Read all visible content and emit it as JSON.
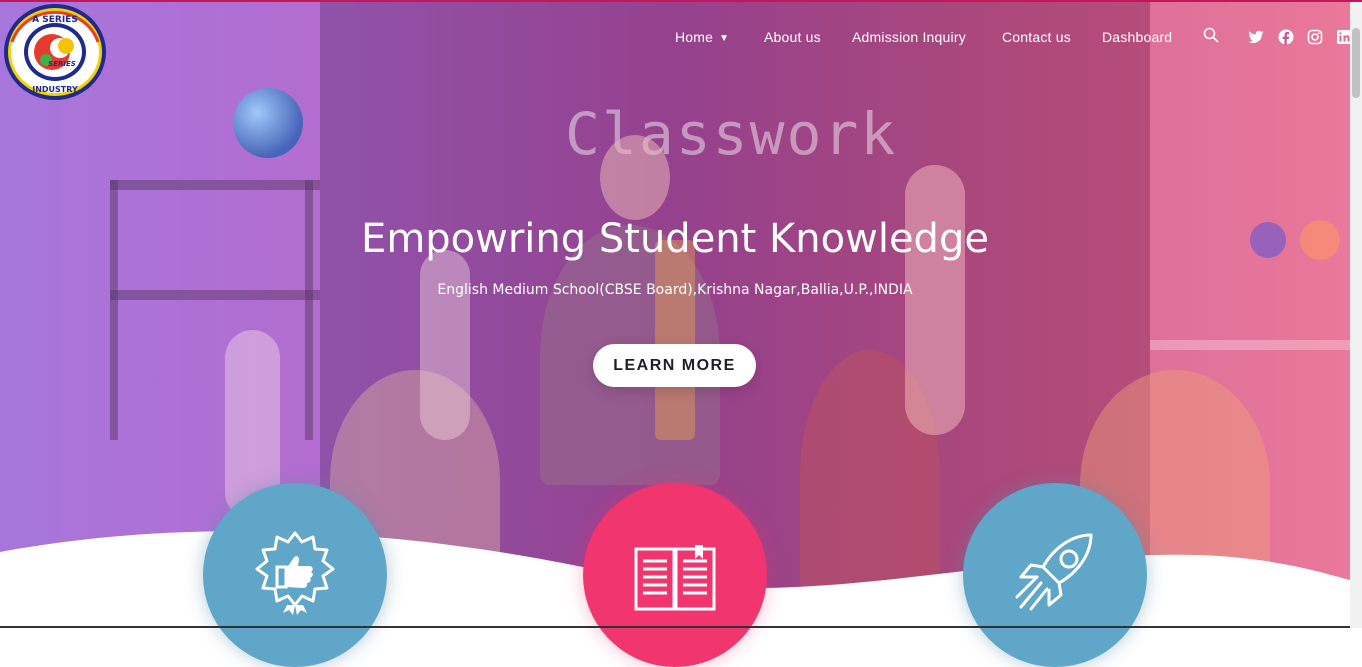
{
  "logo": {
    "top_text": "A SERIES",
    "bottom_text": "INDUSTRY",
    "center_text": "SERIES"
  },
  "nav": {
    "items": [
      {
        "label": "Home",
        "has_dropdown": true
      },
      {
        "label": "About us"
      },
      {
        "label": "Admission Inquiry"
      },
      {
        "label": "Contact us"
      },
      {
        "label": "Dashboard"
      }
    ],
    "icons": [
      "search-icon",
      "twitter-icon",
      "facebook-icon",
      "instagram-icon",
      "linkedin-icon"
    ]
  },
  "hero": {
    "board_text": "Classwork",
    "title": "Empowring Student Knowledge",
    "subtitle": "English Medium School(CBSE Board),Krishna Nagar,Ballia,U.P.,INDIA",
    "cta_label": "LEARN MORE"
  },
  "features": [
    {
      "icon": "thumbs-up-badge-icon",
      "color": "#5fa6c8"
    },
    {
      "icon": "open-book-icon",
      "color": "#f0356f"
    },
    {
      "icon": "rocket-icon",
      "color": "#5fa6c8"
    }
  ],
  "colors": {
    "accent_pink": "#f0356f",
    "accent_blue": "#5fa6c8",
    "top_border": "#c2185b"
  }
}
